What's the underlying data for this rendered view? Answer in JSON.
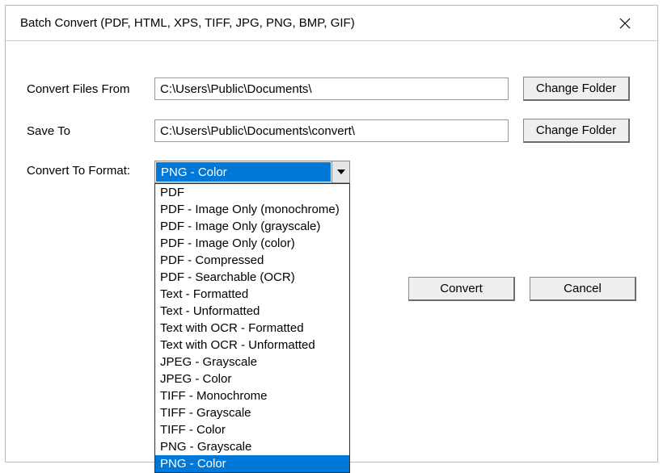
{
  "title": "Batch Convert (PDF, HTML, XPS, TIFF, JPG, PNG, BMP, GIF)",
  "labels": {
    "from": "Convert Files From",
    "saveTo": "Save To",
    "format": "Convert To Format:"
  },
  "inputs": {
    "from": "C:\\Users\\Public\\Documents\\",
    "saveTo": "C:\\Users\\Public\\Documents\\convert\\"
  },
  "buttons": {
    "changeFolder1": "Change Folder",
    "changeFolder2": "Change Folder",
    "convert": "Convert",
    "cancel": "Cancel"
  },
  "format": {
    "selected": "PNG - Color",
    "options": [
      "PDF",
      "PDF - Image Only (monochrome)",
      "PDF - Image Only (grayscale)",
      "PDF - Image Only (color)",
      "PDF - Compressed",
      "PDF - Searchable (OCR)",
      "Text - Formatted",
      "Text - Unformatted",
      "Text with OCR - Formatted",
      "Text with OCR - Unformatted",
      "JPEG - Grayscale",
      "JPEG - Color",
      "TIFF - Monochrome",
      "TIFF - Grayscale",
      "TIFF - Color",
      "PNG - Grayscale",
      "PNG - Color"
    ]
  }
}
